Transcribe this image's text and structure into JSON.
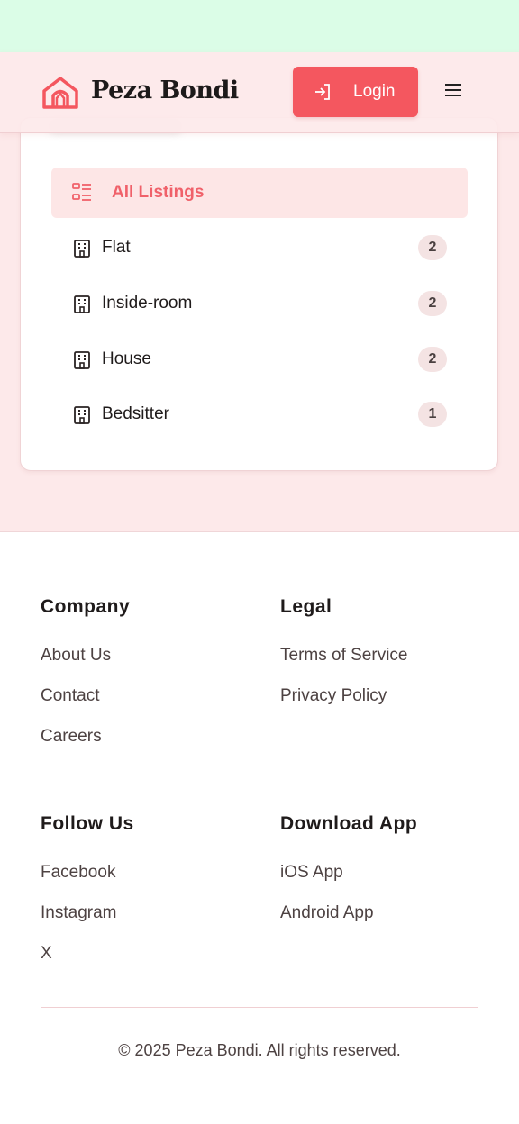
{
  "header": {
    "brand": "Peza Bondi",
    "login_label": "Login"
  },
  "categories": {
    "items": [
      {
        "label": "All Listings",
        "count": ""
      },
      {
        "label": "Flat",
        "count": "2"
      },
      {
        "label": "Inside-room",
        "count": "2"
      },
      {
        "label": "House",
        "count": "2"
      },
      {
        "label": "Bedsitter",
        "count": "1"
      }
    ]
  },
  "footer": {
    "company": {
      "heading": "Company",
      "links": [
        "About Us",
        "Contact",
        "Careers"
      ]
    },
    "legal": {
      "heading": "Legal",
      "links": [
        "Terms of Service",
        "Privacy Policy"
      ]
    },
    "follow": {
      "heading": "Follow Us",
      "links": [
        "Facebook",
        "Instagram",
        "X"
      ]
    },
    "download": {
      "heading": "Download App",
      "links": [
        "iOS App",
        "Android App"
      ]
    },
    "copyright": "© 2025 Peza Bondi. All rights reserved."
  },
  "colors": {
    "accent": "#f4575f",
    "page_bg": "#fde9ea",
    "status_bar": "#dbfde7"
  }
}
